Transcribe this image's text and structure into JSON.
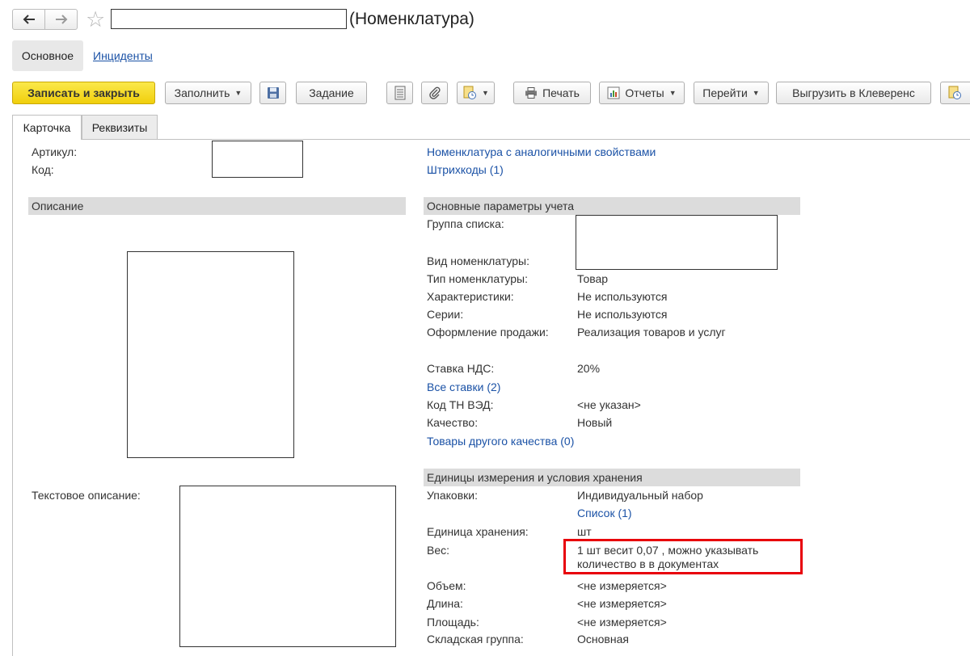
{
  "window": {
    "title": "(Номенклатура)",
    "icons": {
      "back": "arrow-left-icon",
      "forward": "arrow-right-icon",
      "favorite": "star-icon"
    }
  },
  "sections": {
    "main": "Основное",
    "incidents": "Инциденты"
  },
  "toolbar": {
    "save_close": "Записать и закрыть",
    "fill": "Заполнить",
    "task": "Задание",
    "print": "Печать",
    "reports": "Отчеты",
    "goto": "Перейти",
    "export": "Выгрузить в Клеверенс"
  },
  "tabs": {
    "card": "Карточка",
    "requisites": "Реквизиты"
  },
  "left": {
    "article_label": "Артикул:",
    "code_label": "Код:",
    "description_header": "Описание",
    "text_description_label": "Текстовое описание:"
  },
  "right": {
    "links": {
      "analogs": "Номенклатура с аналогичными свойствами",
      "barcodes": "Штрихкоды (1)"
    },
    "accounting": {
      "header": "Основные параметры учета",
      "list_group_label": "Группа списка:",
      "kind_label": "Вид номенклатуры:",
      "type_label": "Тип номенклатуры:",
      "type_value": "Товар",
      "characteristics_label": "Характеристики:",
      "characteristics_value": "Не используются",
      "series_label": "Серии:",
      "series_value": "Не используются",
      "sale_label": "Оформление продажи:",
      "sale_value": "Реализация товаров и услуг",
      "vat_label": "Ставка НДС:",
      "vat_value": "20%",
      "all_rates": "Все ставки (2)",
      "tnved_label": "Код ТН ВЭД:",
      "tnved_value": "<не указан>",
      "quality_label": "Качество:",
      "quality_value": "Новый",
      "other_quality": "Товары другого качества (0)"
    },
    "units": {
      "header": "Единицы измерения и условия хранения",
      "packs_label": "Упаковки:",
      "packs_value": "Индивидуальный набор",
      "packs_list": "Список (1)",
      "storage_unit_label": "Единица хранения:",
      "storage_unit_value": "шт",
      "weight_label": "Вес:",
      "weight_line1": "1 шт весит 0,07 , можно указывать",
      "weight_line2": "количество в  в документах",
      "volume_label": "Объем:",
      "volume_value": "<не измеряется>",
      "length_label": "Длина:",
      "length_value": "<не измеряется>",
      "area_label": "Площадь:",
      "area_value": "<не измеряется>",
      "warehouse_label": "Складская группа:",
      "warehouse_value": "Основная"
    }
  },
  "colors": {
    "primary_button": "#f5d90f",
    "link": "#1b52a6",
    "highlight": "#e8000b",
    "section_header": "#dcdcdc"
  }
}
